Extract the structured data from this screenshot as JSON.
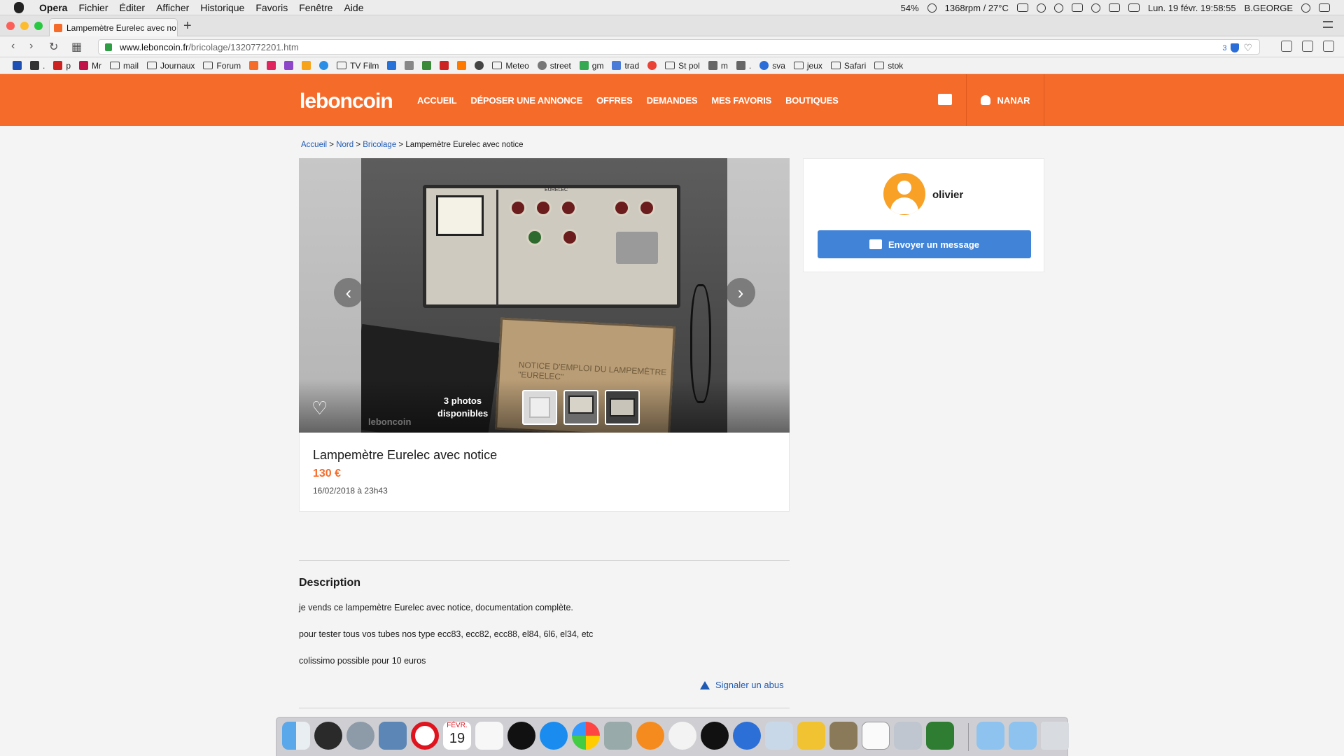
{
  "menubar": {
    "app": "Opera",
    "items": [
      "Fichier",
      "Éditer",
      "Afficher",
      "Historique",
      "Favoris",
      "Fenêtre",
      "Aide"
    ],
    "battery": "54%",
    "fan": "1368rpm / 27°C",
    "datetime": "Lun. 19 févr.  19:58:55",
    "user": "B.GEORGE"
  },
  "tab": {
    "title": "Lampemètre Eurelec avec no",
    "close": "×",
    "new": "+"
  },
  "address": {
    "host": "www.leboncoin.fr",
    "path": "/bricolage/1320772201.htm",
    "badge": "3"
  },
  "bookmarks": [
    {
      "label": "p",
      "icon": "folder"
    },
    {
      "label": ".",
      "icon": "app"
    },
    {
      "label": "p",
      "icon": "app"
    },
    {
      "label": "Mr",
      "icon": "app"
    },
    {
      "label": "mail",
      "icon": "folder"
    },
    {
      "label": "Journaux",
      "icon": "folder"
    },
    {
      "label": "Forum",
      "icon": "folder"
    },
    {
      "label": "TV Film",
      "icon": "folder"
    },
    {
      "label": "Meteo",
      "icon": "folder"
    },
    {
      "label": "street",
      "icon": "app"
    },
    {
      "label": "gm",
      "icon": "app"
    },
    {
      "label": "trad",
      "icon": "app"
    },
    {
      "label": "St pol",
      "icon": "folder"
    },
    {
      "label": "m",
      "icon": "app"
    },
    {
      "label": ".",
      "icon": "app"
    },
    {
      "label": "sva",
      "icon": "app"
    },
    {
      "label": "jeux",
      "icon": "folder"
    },
    {
      "label": "Safari",
      "icon": "folder"
    },
    {
      "label": "stok",
      "icon": "folder"
    }
  ],
  "site": {
    "logo": "leboncoin",
    "nav": [
      "ACCUEIL",
      "DÉPOSER UNE ANNONCE",
      "OFFRES",
      "DEMANDES",
      "MES FAVORIS",
      "BOUTIQUES"
    ],
    "user": "NANAR",
    "accent": "#f56b2a"
  },
  "breadcrumb": {
    "home": "Accueil",
    "region": "Nord",
    "category": "Bricolage",
    "current": "Lampemètre Eurelec avec notice",
    "sep": ">"
  },
  "gallery": {
    "count_line1": "3 photos",
    "count_line2": "disponibles",
    "watermark": "leboncoin",
    "prev": "‹",
    "next": "›",
    "heart": "♡",
    "notice_text": "NOTICE D'EMPLOI DU LAMPEMÈTRE \"EURELEC\"",
    "brand": "EURELEC"
  },
  "ad": {
    "title": "Lampemètre Eurelec avec notice",
    "price": "130 €",
    "date": "16/02/2018 à 23h43"
  },
  "description": {
    "heading": "Description",
    "lines": [
      "je vends ce lampemètre Eurelec avec notice, documentation complète.",
      "pour tester tous vos tubes nos type ecc83, ecc82, ecc88, el84, 6l6, el34, etc",
      "colissimo possible pour 10 euros"
    ],
    "report": "Signaler un abus"
  },
  "seller": {
    "name": "olivier",
    "button": "Envoyer un message"
  },
  "dock": {
    "calendar_month": "FÉVR.",
    "calendar_day": "19"
  }
}
